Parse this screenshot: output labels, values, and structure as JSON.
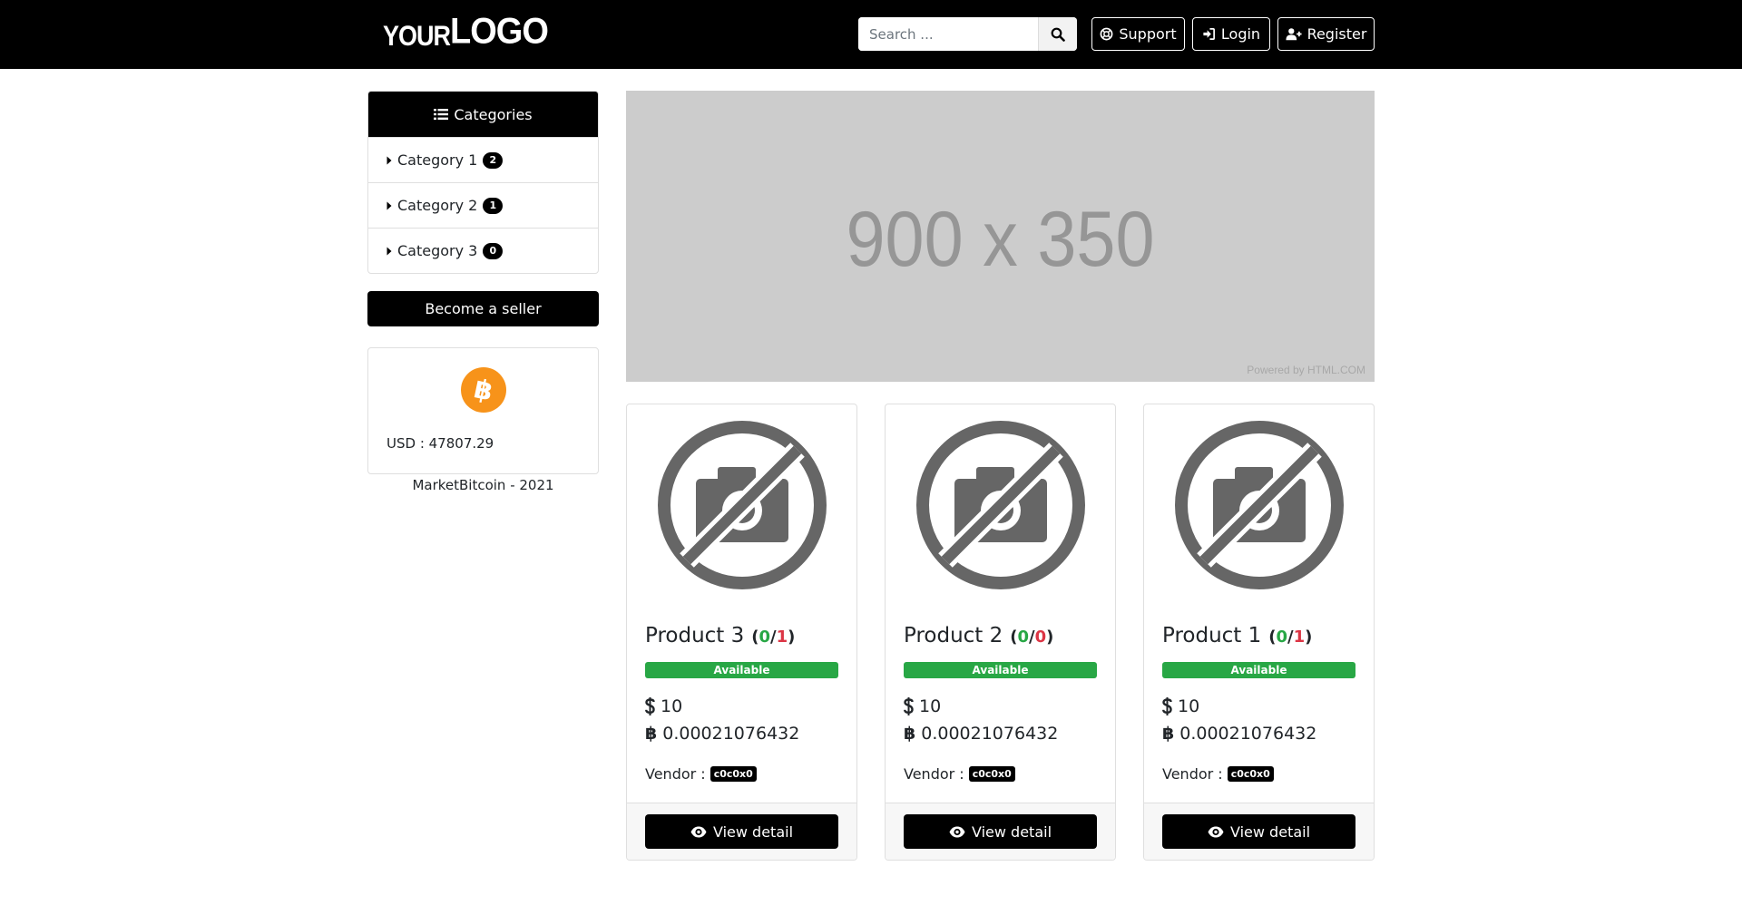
{
  "header": {
    "logo_small": "YOUR",
    "logo_big": "LOGO",
    "search_placeholder": "Search ...",
    "support_label": "Support",
    "login_label": "Login",
    "register_label": "Register"
  },
  "sidebar": {
    "categories_title": "Categories",
    "categories": [
      {
        "label": "Category 1",
        "count": "2"
      },
      {
        "label": "Category 2",
        "count": "1"
      },
      {
        "label": "Category 3",
        "count": "0"
      }
    ],
    "seller_label": "Become a seller",
    "btc_rate": "USD : 47807.29",
    "footer": "MarketBitcoin - 2021"
  },
  "banner": {
    "text": "900 x 350",
    "powered": "Powered by HTML.COM"
  },
  "products": [
    {
      "title": "Product 3",
      "positive": "0",
      "negative": "1",
      "status": "Available",
      "price_usd": "10",
      "price_btc": "0.00021076432",
      "vendor_label": "Vendor :",
      "vendor": "c0c0x0",
      "button": "View detail"
    },
    {
      "title": "Product 2",
      "positive": "0",
      "negative": "0",
      "status": "Available",
      "price_usd": "10",
      "price_btc": "0.00021076432",
      "vendor_label": "Vendor :",
      "vendor": "c0c0x0",
      "button": "View detail"
    },
    {
      "title": "Product 1",
      "positive": "0",
      "negative": "1",
      "status": "Available",
      "price_usd": "10",
      "price_btc": "0.00021076432",
      "vendor_label": "Vendor :",
      "vendor": "c0c0x0",
      "button": "View detail"
    }
  ],
  "colors": {
    "navbar": "#000000",
    "available": "#28a745",
    "positive": "#28a745",
    "negative": "#dc3545",
    "bitcoin": "#f7931a",
    "banner": "#cccccc"
  },
  "icons": {
    "search": "search-icon",
    "support": "lifebuoy-icon",
    "login": "sign-in-icon",
    "register": "user-plus-icon",
    "categories": "list-icon",
    "category": "caret-right-icon",
    "bitcoin": "bitcoin-icon",
    "no_image": "no-camera-icon",
    "view": "eye-icon"
  }
}
